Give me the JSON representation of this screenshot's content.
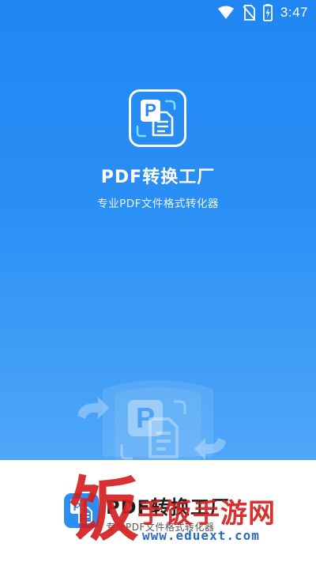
{
  "status_bar": {
    "time": "3:47",
    "icons": [
      "wifi-icon",
      "no-sim-icon",
      "battery-charging-icon"
    ]
  },
  "splash": {
    "app_icon": "pdf-document-icon",
    "title": "PDF转换工厂",
    "subtitle": "专业PDF文件格式转化器",
    "illustration": "pdf-convert-illustration",
    "colors": {
      "gradient_top": "#1f86f3",
      "gradient_bottom": "#4fa7f8"
    }
  },
  "brand_footer": {
    "logo": "pdf-app-logo-icon",
    "name": "PDF转换工厂",
    "tagline": "专业PDF文件格式转化器"
  },
  "watermark": {
    "big_char": "饭",
    "name": "手饭手游网",
    "url": "www.eduext.com"
  }
}
